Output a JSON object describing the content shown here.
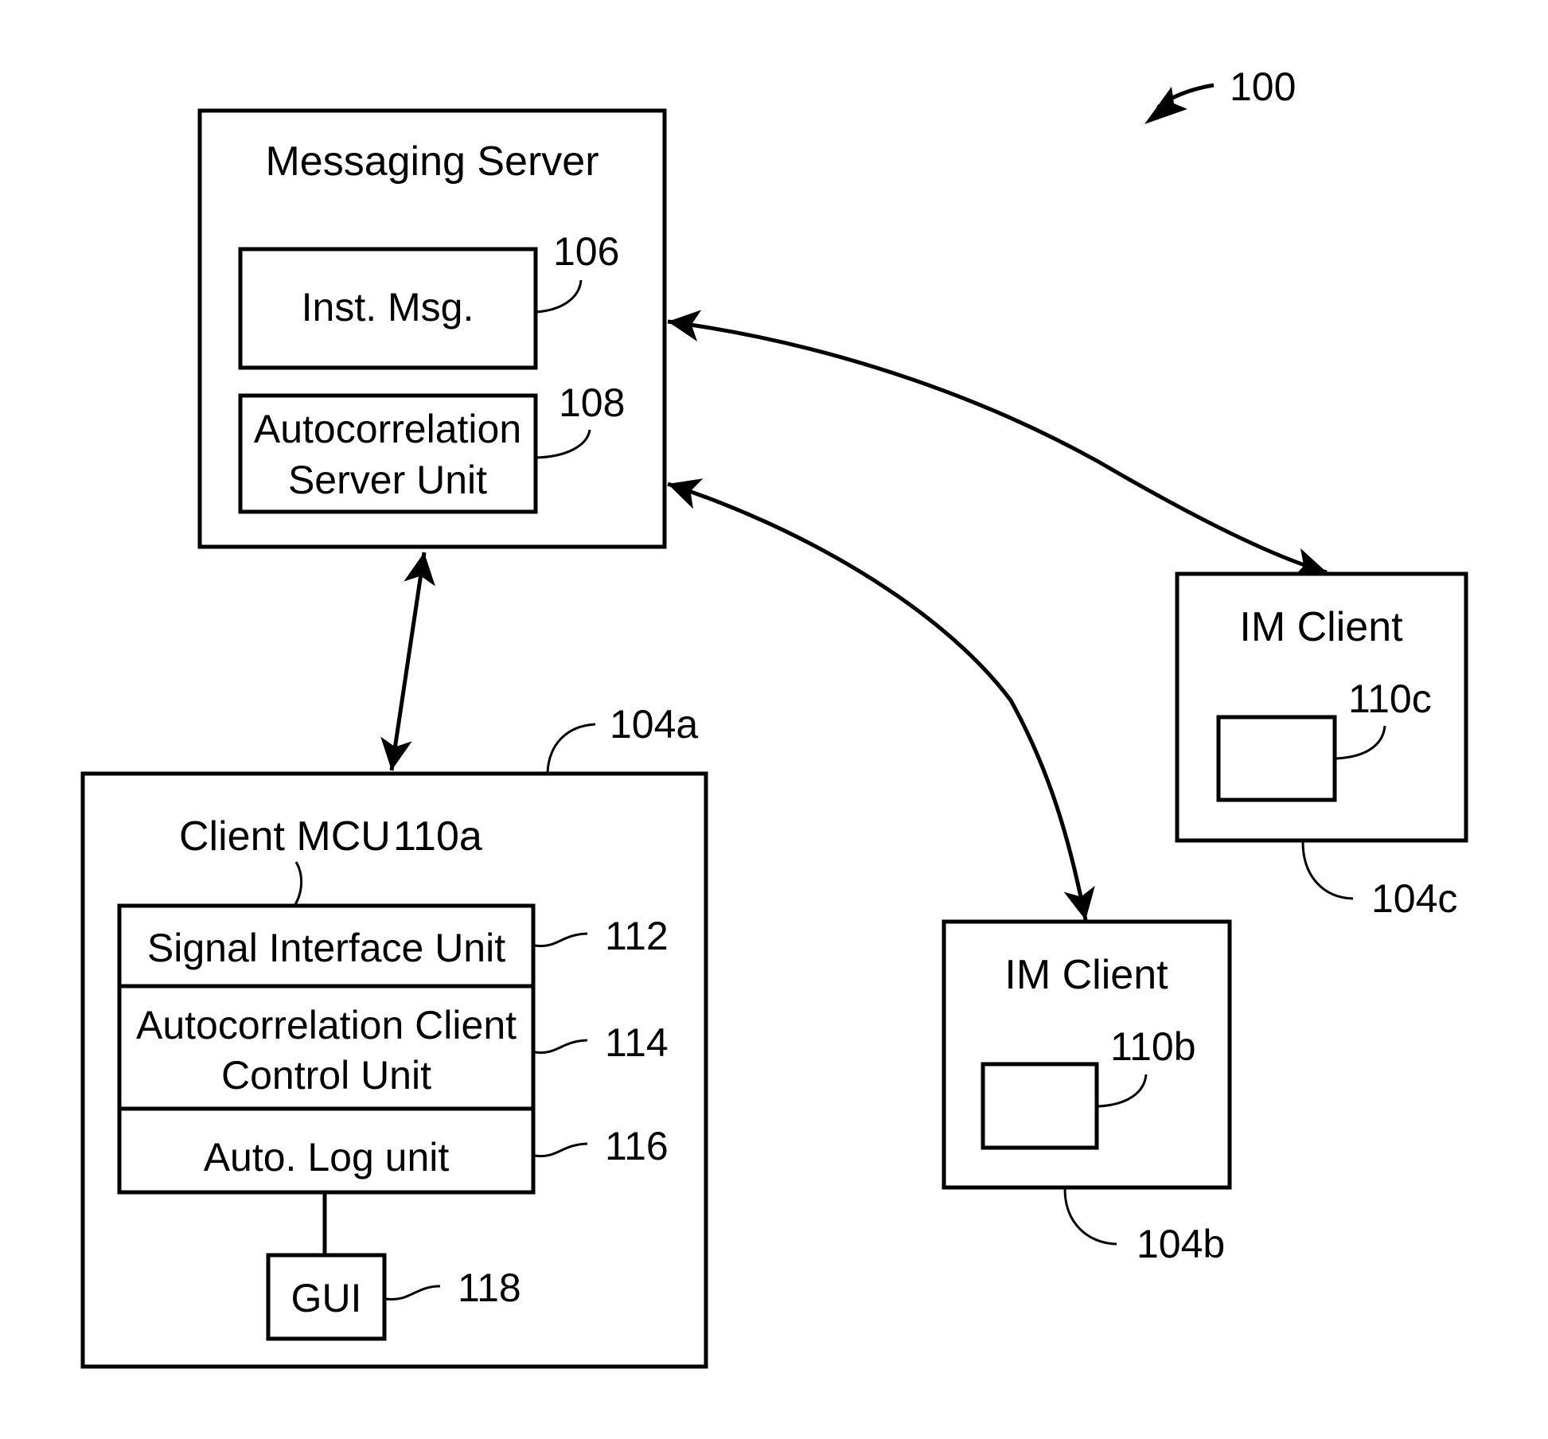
{
  "figure": {
    "reference": "100",
    "colors": {
      "ink": "#000000",
      "background": "#ffffff"
    }
  },
  "messaging_server": {
    "title": "Messaging Server",
    "inst_msg": {
      "label": "Inst. Msg.",
      "ref": "106"
    },
    "autocorrelation_server_unit": {
      "line1": "Autocorrelation",
      "line2": "Server Unit",
      "ref": "108"
    }
  },
  "client_a": {
    "ref": "104a",
    "mcu_label": "Client MCU",
    "mcu_ref": "110a",
    "units": [
      {
        "lines": [
          "Signal Interface Unit"
        ],
        "ref": "112"
      },
      {
        "lines": [
          "Autocorrelation Client",
          "Control Unit"
        ],
        "ref": "114"
      },
      {
        "lines": [
          "Auto. Log unit"
        ],
        "ref": "116"
      }
    ],
    "gui": {
      "label": "GUI",
      "ref": "118"
    }
  },
  "client_b": {
    "title": "IM Client",
    "inner_ref": "110b",
    "ref": "104b"
  },
  "client_c": {
    "title": "IM Client",
    "inner_ref": "110c",
    "ref": "104c"
  },
  "connections": [
    {
      "from": "Messaging Server",
      "to": "Client 104a",
      "bidirectional": true
    },
    {
      "from": "Messaging Server",
      "to": "IM Client 104b",
      "bidirectional": true
    },
    {
      "from": "Messaging Server",
      "to": "IM Client 104c",
      "bidirectional": true
    }
  ]
}
